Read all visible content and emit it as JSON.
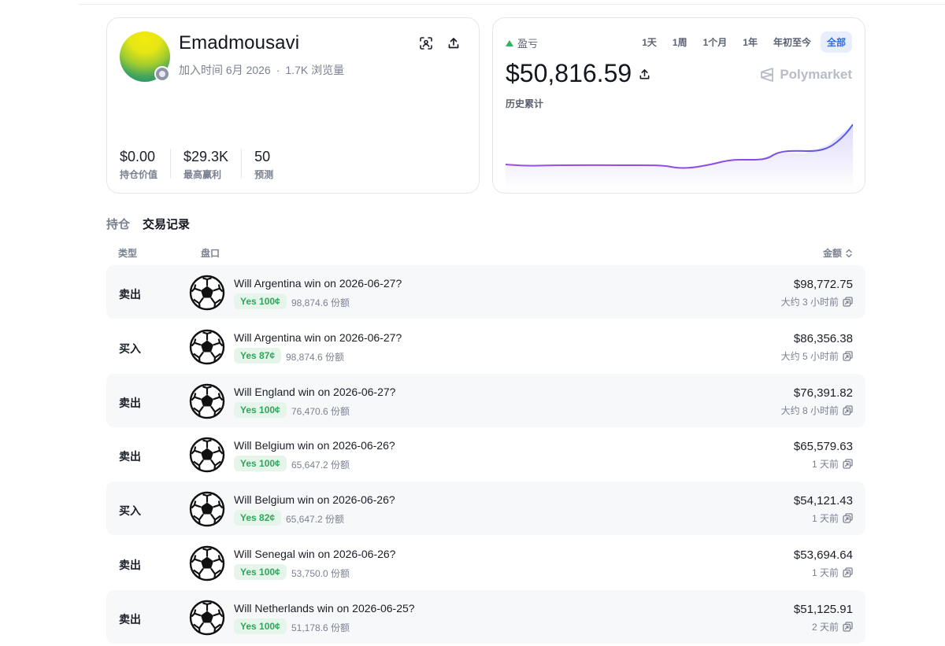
{
  "profile": {
    "username": "Emadmousavi",
    "joined": "加入时间 6月 2026",
    "views": "1.7K 浏览量",
    "stats": [
      {
        "value": "$0.00",
        "label": "持仓价值"
      },
      {
        "value": "$29.3K",
        "label": "最高赢利"
      },
      {
        "value": "50",
        "label": "预测"
      }
    ]
  },
  "pnl": {
    "label": "盈亏",
    "value": "$50,816.59",
    "sub": "历史累计",
    "brand": "Polymarket",
    "ranges": [
      "1天",
      "1周",
      "1个月",
      "1年",
      "年初至今",
      "全部"
    ],
    "active_range": "全部",
    "colors": {
      "line": "#7b49e8",
      "up": "#2fb463"
    }
  },
  "tabs": {
    "positions": "持仓",
    "activity": "交易记录"
  },
  "table_head": {
    "type": "类型",
    "market": "盘口",
    "amount": "金额"
  },
  "trades": [
    {
      "side": "卖出",
      "title": "Will Argentina win on 2026-06-27?",
      "outcome": "Yes 100¢",
      "shares": "98,874.6 份额",
      "amount": "$98,772.75",
      "time": "大约 3 小时前"
    },
    {
      "side": "买入",
      "title": "Will Argentina win on 2026-06-27?",
      "outcome": "Yes 87¢",
      "shares": "98,874.6 份额",
      "amount": "$86,356.38",
      "time": "大约 5 小时前"
    },
    {
      "side": "卖出",
      "title": "Will England win on 2026-06-27?",
      "outcome": "Yes 100¢",
      "shares": "76,470.6 份额",
      "amount": "$76,391.82",
      "time": "大约 8 小时前"
    },
    {
      "side": "卖出",
      "title": "Will Belgium win on 2026-06-26?",
      "outcome": "Yes 100¢",
      "shares": "65,647.2 份额",
      "amount": "$65,579.63",
      "time": "1 天前"
    },
    {
      "side": "买入",
      "title": "Will Belgium win on 2026-06-26?",
      "outcome": "Yes 82¢",
      "shares": "65,647.2 份额",
      "amount": "$54,121.43",
      "time": "1 天前"
    },
    {
      "side": "卖出",
      "title": "Will Senegal win on 2026-06-26?",
      "outcome": "Yes 100¢",
      "shares": "53,750.0 份额",
      "amount": "$53,694.64",
      "time": "1 天前"
    },
    {
      "side": "卖出",
      "title": "Will Netherlands win on 2026-06-25?",
      "outcome": "Yes 100¢",
      "shares": "51,178.6 份额",
      "amount": "$51,125.91",
      "time": "2 天前"
    }
  ]
}
